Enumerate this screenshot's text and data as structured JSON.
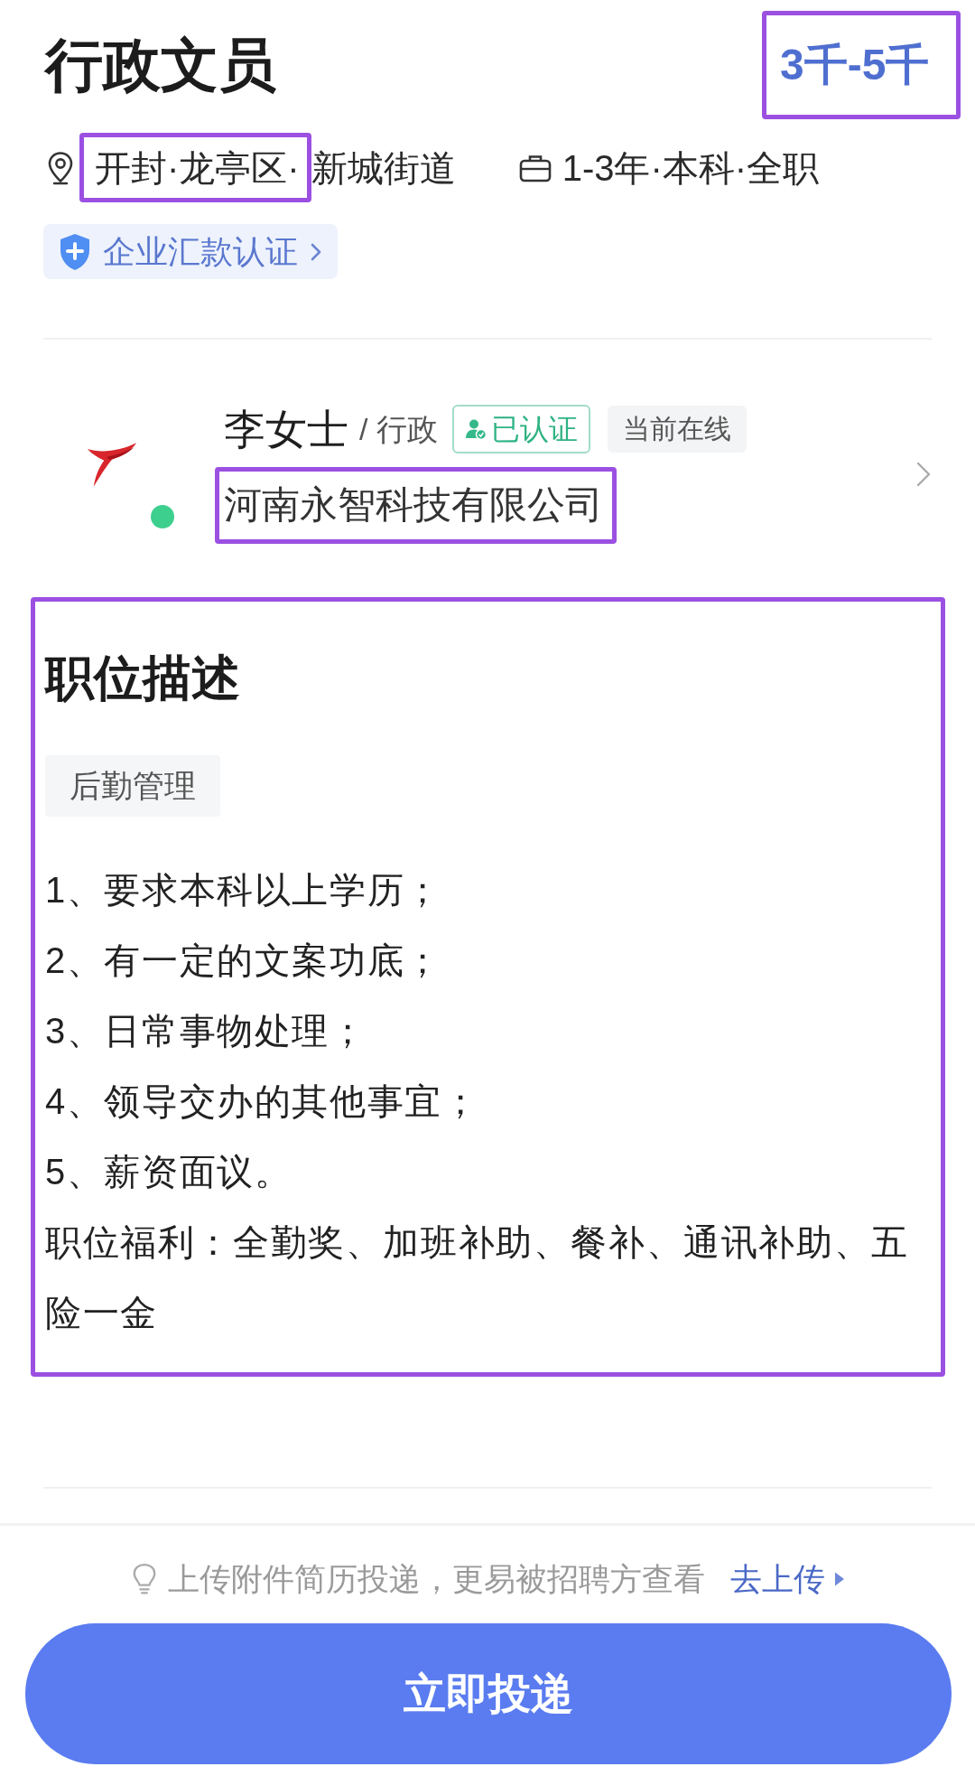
{
  "job": {
    "title": "行政文员",
    "salary": {
      "text": "3千-5千",
      "highlighted": true
    }
  },
  "location": {
    "parts": [
      {
        "text": "开封·龙亭区·",
        "highlighted": true
      },
      {
        "text": "新城街道",
        "highlighted": false
      }
    ]
  },
  "requirements": "1-3年·本科·全职",
  "certification_badge": {
    "label": "企业汇款认证"
  },
  "recruiter": {
    "name": "李女士",
    "role": "/ 行政",
    "verified_label": "已认证",
    "status": "当前在线",
    "online": true,
    "company": {
      "text": "河南永智科技有限公司",
      "highlighted": true
    }
  },
  "description": {
    "highlighted": true,
    "heading": "职位描述",
    "tags": [
      {
        "label": "后勤管理"
      }
    ],
    "lines": [
      "1、要求本科以上学历；",
      "2、有一定的文案功底；",
      "3、日常事物处理；",
      "4、领导交办的其他事宜；",
      "5、薪资面议。",
      "职位福利：全勤奖、加班补助、餐补、通讯补助、五险一金"
    ]
  },
  "upload_hint": {
    "text": "上传附件简历投递，更易被招聘方查看",
    "link": "去上传"
  },
  "apply_button": {
    "label": "立即投递"
  }
}
